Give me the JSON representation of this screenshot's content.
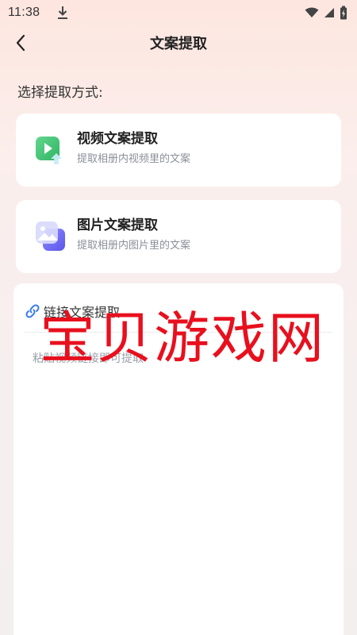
{
  "status_bar": {
    "time": "11:38",
    "icons": [
      "download-icon",
      "wifi-icon",
      "signal-icon",
      "battery-icon"
    ]
  },
  "nav": {
    "title": "文案提取",
    "back_icon": "chevron-left-icon"
  },
  "section_label": "选择提取方式:",
  "cards": [
    {
      "title": "视频文案提取",
      "subtitle": "提取相册内视频里的文案",
      "icon": "video-play-icon"
    },
    {
      "title": "图片文案提取",
      "subtitle": "提取相册内图片里的文案",
      "icon": "image-icon"
    }
  ],
  "link_extract": {
    "title": "链接文案提取",
    "icon": "link-icon",
    "placeholder": "粘贴视频链接即可提取",
    "value": ""
  },
  "watermark": "宝贝游戏网",
  "colors": {
    "video_icon": "#3fbf74",
    "image_icon": "#6f6cf3",
    "link_icon": "#3a7bf0",
    "watermark": "#e8101e",
    "subtitle": "#8a8f99"
  }
}
